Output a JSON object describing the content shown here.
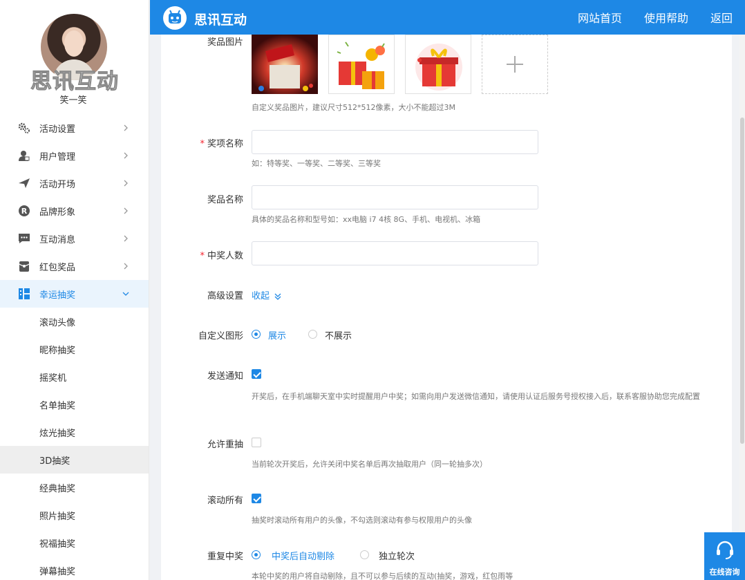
{
  "sidebar": {
    "brand_overlay": "思讯互动",
    "username": "笑一笑",
    "menu": [
      {
        "label": "活动设置",
        "icon": "gears-icon"
      },
      {
        "label": "用户管理",
        "icon": "user-lock-icon"
      },
      {
        "label": "活动开场",
        "icon": "paper-plane-icon"
      },
      {
        "label": "品牌形象",
        "icon": "registered-icon"
      },
      {
        "label": "互动消息",
        "icon": "chat-icon"
      },
      {
        "label": "红包奖品",
        "icon": "red-packet-icon"
      },
      {
        "label": "幸运抽奖",
        "icon": "lottery-icon"
      }
    ],
    "submenu": [
      "滚动头像",
      "昵称抽奖",
      "摇奖机",
      "名单抽奖",
      "炫光抽奖",
      "3D抽奖",
      "经典抽奖",
      "照片抽奖",
      "祝福抽奖",
      "弹幕抽奖"
    ],
    "active_menu": "幸运抽奖",
    "selected_submenu": "3D抽奖"
  },
  "header": {
    "title": "思讯互动",
    "nav": [
      "网站首页",
      "使用帮助",
      "返回"
    ]
  },
  "form": {
    "prize_image": {
      "label": "奖品图片",
      "hint": "自定义奖品图片，建议尺寸512*512像素，大小不能超过3M"
    },
    "award_name": {
      "label": "奖项名称",
      "value": "",
      "placeholder": "",
      "hint": "如：特等奖、一等奖、二等奖、三等奖"
    },
    "prize_name": {
      "label": "奖品名称",
      "value": "",
      "placeholder": "",
      "hint": "具体的奖品名称和型号如：xx电脑 i7 4核 8G、手机、电视机、冰箱"
    },
    "winner_count": {
      "label": "中奖人数",
      "value": "",
      "placeholder": ""
    },
    "advanced": {
      "label": "高级设置",
      "toggle": "收起"
    },
    "custom_shape": {
      "label": "自定义图形",
      "options": [
        "展示",
        "不展示"
      ],
      "selected": "展示"
    },
    "send_notice": {
      "label": "发送通知",
      "checked": true,
      "hint": "开奖后，在手机端聊天室中实时提醒用户中奖；如需向用户发送微信通知，请使用认证后服务号授权接入后，联系客服协助您完成配置"
    },
    "allow_redraw": {
      "label": "允许重抽",
      "checked": false,
      "hint": "当前轮次开奖后，允许关闭中奖名单后再次抽取用户（同一轮抽多次）"
    },
    "scroll_all": {
      "label": "滚动所有",
      "checked": true,
      "hint": "抽奖时滚动所有用户的头像，不勾选则滚动有参与权限用户的头像"
    },
    "repeat_win": {
      "label": "重复中奖",
      "options": [
        "中奖后自动剔除",
        "独立轮次"
      ],
      "selected": "中奖后自动剔除",
      "hint": "本轮中奖的用户将自动剔除，且不可以参与后续的互动(抽奖，游戏，红包雨等"
    }
  },
  "chat": {
    "label": "在线咨询"
  },
  "colors": {
    "accent": "#1e88e5",
    "required": "#f5222d"
  }
}
